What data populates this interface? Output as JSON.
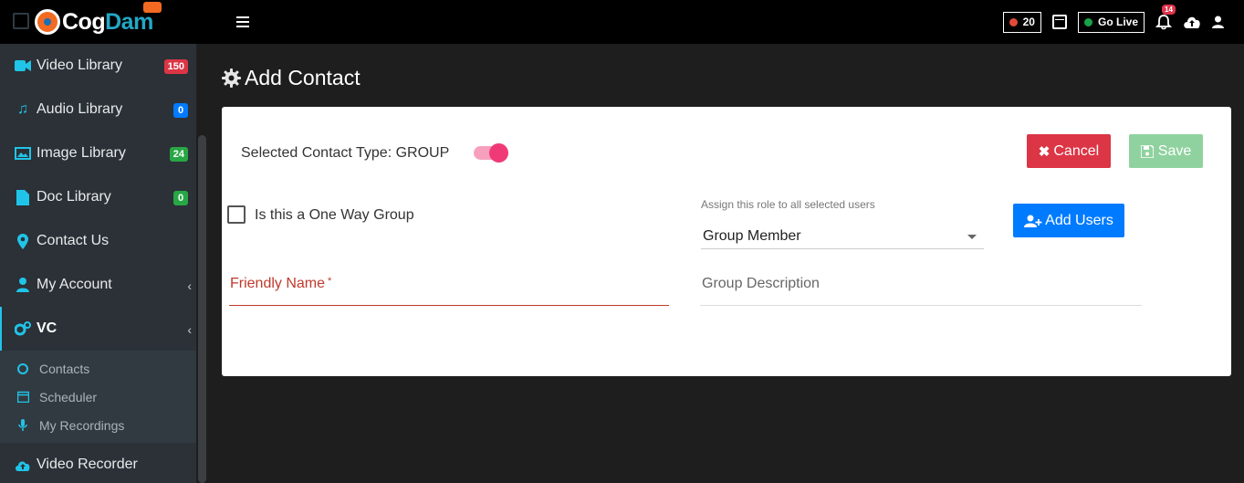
{
  "logo": {
    "part1": "Cog",
    "part2": "Dam"
  },
  "sidebar": {
    "items": [
      {
        "label": "Video Library",
        "badge": "150",
        "icon": "video-icon"
      },
      {
        "label": "Audio Library",
        "badge": "0",
        "icon": "music-icon"
      },
      {
        "label": "Image Library",
        "badge": "24",
        "icon": "image-icon"
      },
      {
        "label": "Doc Library",
        "badge": "0",
        "icon": "document-icon"
      },
      {
        "label": "Contact Us",
        "icon": "map-marker-icon"
      },
      {
        "label": "My Account",
        "icon": "user-icon"
      },
      {
        "label": "VC",
        "icon": "cogs-icon"
      }
    ],
    "vc_sub": [
      {
        "label": "Contacts",
        "icon": "circle-icon"
      },
      {
        "label": "Scheduler",
        "icon": "calendar-icon"
      },
      {
        "label": "My Recordings",
        "icon": "microphone-icon"
      }
    ],
    "video_recorder": {
      "label": "Video Recorder",
      "icon": "cloud-upload-icon"
    }
  },
  "topbar": {
    "recording_count": "20",
    "go_live_label": "Go Live",
    "notifications_count": "14"
  },
  "page": {
    "title": "Add Contact"
  },
  "form": {
    "contact_type_label": "Selected Contact Type: GROUP",
    "cancel_label": "Cancel",
    "save_label": "Save",
    "one_way_label": "Is this a One Way Group",
    "assign_role_label": "Assign this role to all selected users",
    "role_value": "Group Member",
    "add_users_label": "Add Users",
    "friendly_name_label": "Friendly Name",
    "required_mark": "*",
    "group_description_label": "Group Description"
  },
  "colors": {
    "accent": "#20c4e8",
    "danger": "#dc3545",
    "primary": "#007bff",
    "success": "#28a745",
    "toggle": "#f03a78"
  }
}
